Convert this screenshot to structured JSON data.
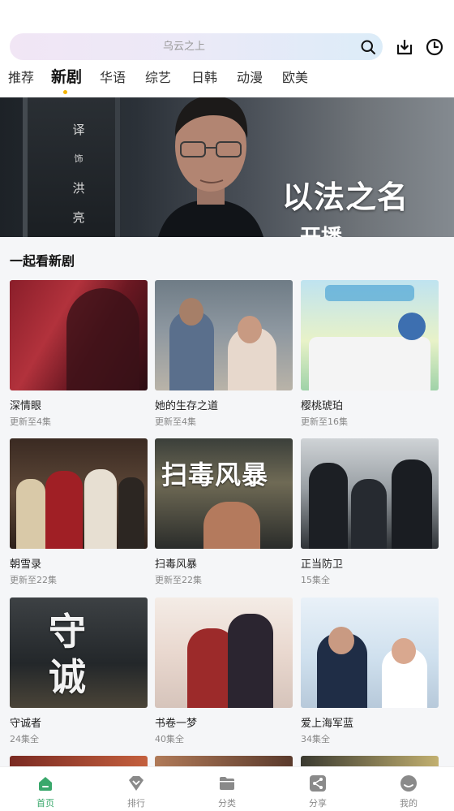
{
  "search": {
    "placeholder": "乌云之上"
  },
  "tabs": [
    {
      "label": "推荐"
    },
    {
      "label": "新剧"
    },
    {
      "label": "华语"
    },
    {
      "label": "综艺"
    },
    {
      "label": "日韩"
    },
    {
      "label": "动漫"
    },
    {
      "label": "欧美"
    }
  ],
  "active_tab": "新剧",
  "banner": {
    "title": "以法之名",
    "subtitle": "开播",
    "credits": [
      "译",
      "饰",
      "洪",
      "亮"
    ]
  },
  "section": {
    "title": "一起看新剧"
  },
  "cards": [
    {
      "title": "深情眼",
      "status": "更新至4集"
    },
    {
      "title": "她的生存之道",
      "status": "更新至4集"
    },
    {
      "title": "樱桃琥珀",
      "status": "更新至16集"
    },
    {
      "title": "朝雪录",
      "status": "更新至22集"
    },
    {
      "title": "扫毒风暴",
      "status": "更新至22集",
      "poster_text": "扫毒风暴"
    },
    {
      "title": "正当防卫",
      "status": "15集全"
    },
    {
      "title": "守诚者",
      "status": "24集全",
      "poster_text": "守诚"
    },
    {
      "title": "书卷一梦",
      "status": "40集全"
    },
    {
      "title": "爱上海军蓝",
      "status": "34集全"
    }
  ],
  "nav": [
    {
      "label": "首页",
      "icon": "home-icon",
      "active": true
    },
    {
      "label": "排行",
      "icon": "rank-icon",
      "active": false
    },
    {
      "label": "分类",
      "icon": "folder-icon",
      "active": false
    },
    {
      "label": "分享",
      "icon": "share-icon",
      "active": false
    },
    {
      "label": "我的",
      "icon": "profile-icon",
      "active": false
    }
  ],
  "colors": {
    "accent": "#3aa86c",
    "tab_dot": "#f4b400"
  }
}
